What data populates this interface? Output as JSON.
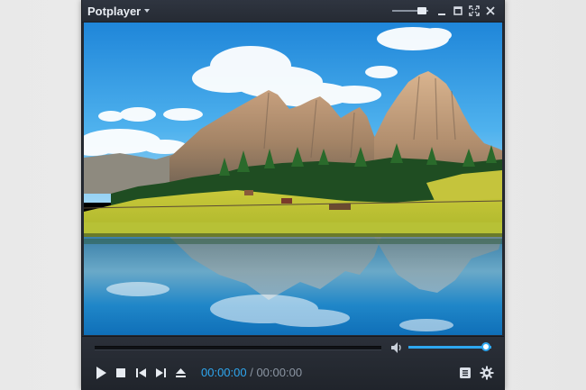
{
  "window": {
    "title": "Potplayer",
    "menu_icon": "chevron-down-icon",
    "controls": [
      "opacity-slider",
      "minimize-icon",
      "maximize-icon",
      "fullscreen-icon",
      "close-icon"
    ]
  },
  "video": {
    "scene": "mountain-lake-landscape"
  },
  "playback": {
    "current_time": "00:00:00",
    "separator": " / ",
    "duration": "00:00:00",
    "progress": 0,
    "volume": 1.0
  },
  "icons": {
    "play": "play-icon",
    "stop": "stop-icon",
    "previous": "previous-icon",
    "next": "next-icon",
    "eject": "eject-icon",
    "volume": "speaker-icon",
    "playlist": "playlist-icon",
    "settings": "gear-icon"
  },
  "colors": {
    "accent": "#2ea7f0",
    "frame": "#252a33",
    "text": "#e8ecf2",
    "muted_text": "#8c96a3"
  }
}
